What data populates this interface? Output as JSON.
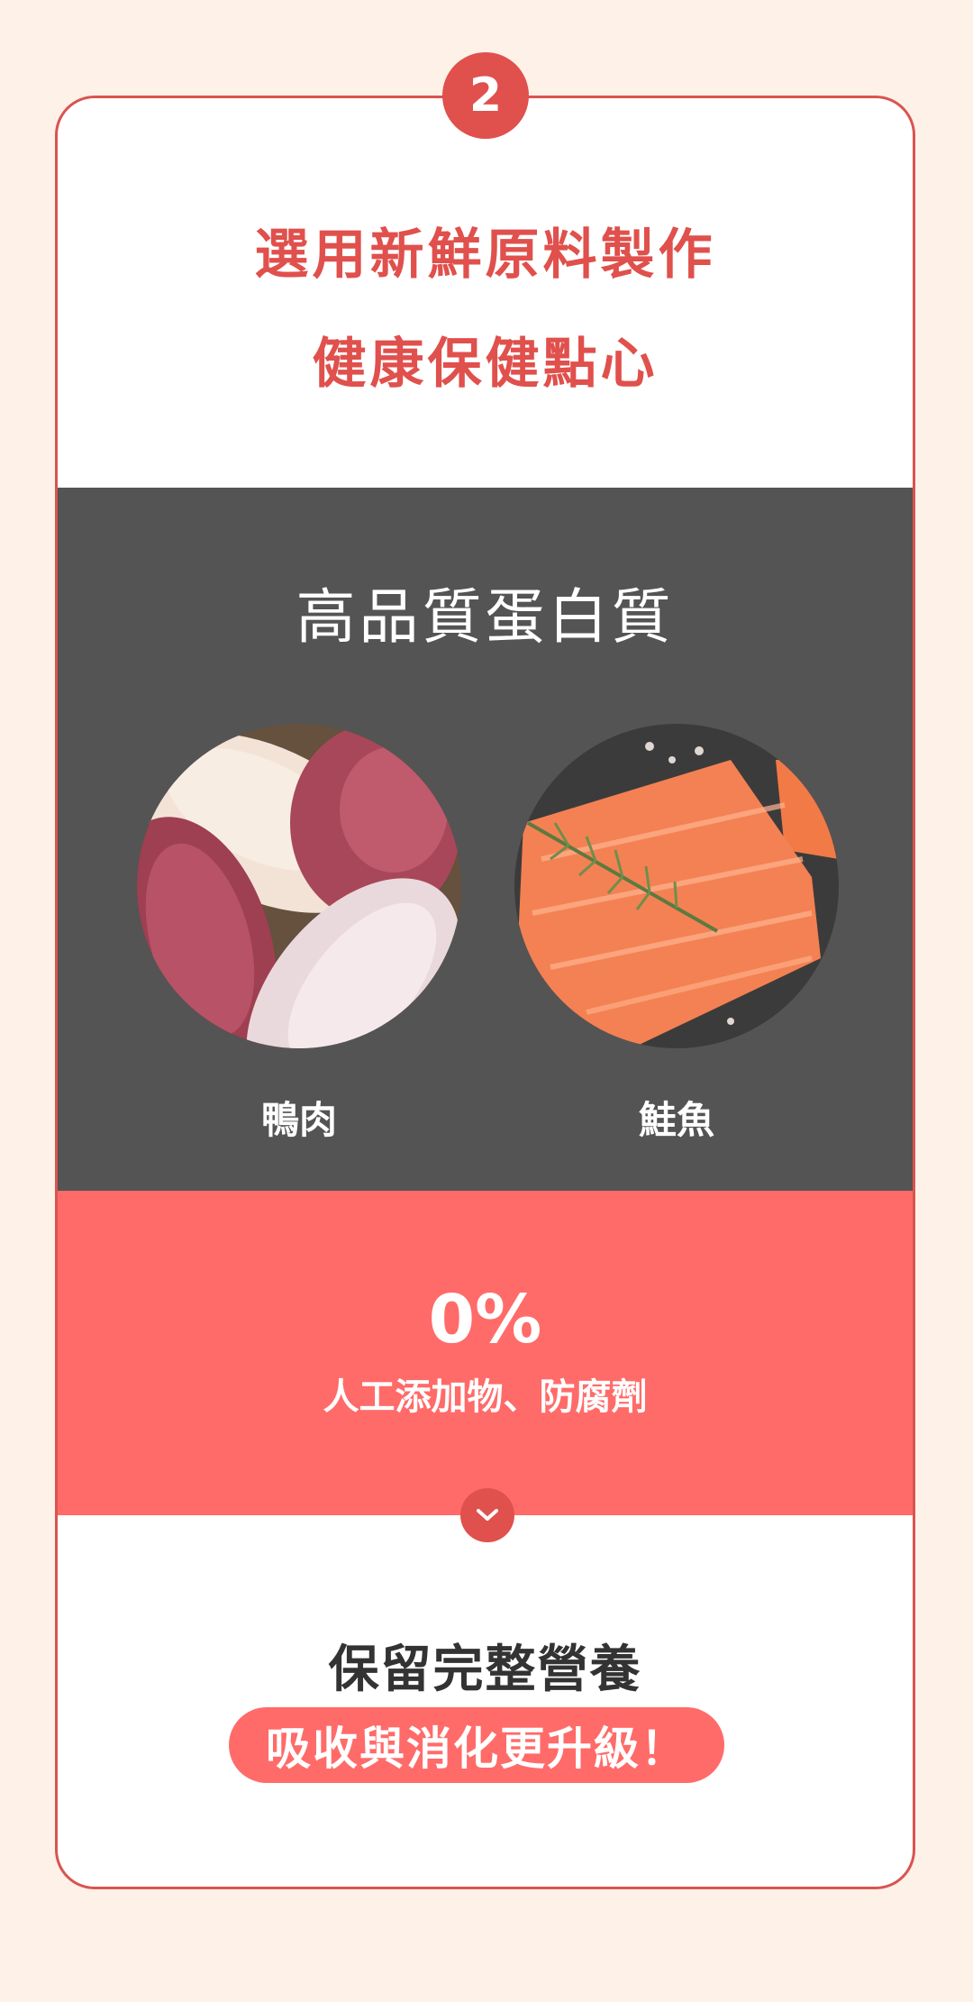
{
  "step": {
    "number": "2"
  },
  "headline": {
    "line1": "選用新鮮原料製作",
    "line2": "健康保健點心"
  },
  "protein": {
    "title": "高品質蛋白質",
    "items": [
      {
        "label": "鴨肉",
        "image": "duck-meat-photo"
      },
      {
        "label": "鮭魚",
        "image": "salmon-fillet-photo"
      }
    ]
  },
  "additive": {
    "percent": "0%",
    "text": "人工添加物、防腐劑"
  },
  "nutrition": {
    "title": "保留完整營養",
    "highlight": "吸收與消化更升級！"
  },
  "colors": {
    "page_bg": "#fdf1e8",
    "accent_red": "#e0504c",
    "coral": "#ff6b69",
    "dark_panel": "#545454"
  }
}
